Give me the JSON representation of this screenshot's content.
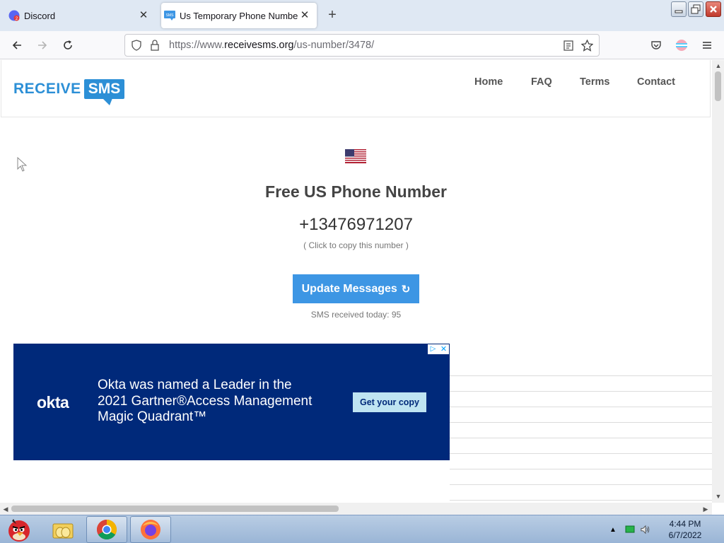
{
  "browser": {
    "tabs": [
      {
        "title": "Discord",
        "favicon": "discord-icon",
        "active": false
      },
      {
        "title": "Us Temporary Phone Numbe",
        "favicon": "receivesms-icon",
        "active": true
      }
    ],
    "new_tab_icon": "plus-icon",
    "url": {
      "prefix": "https://www.",
      "domain": "receivesms.org",
      "path": "/us-number/3478/"
    }
  },
  "site": {
    "logo": {
      "part1": "RECEIVE",
      "part2": "SMS"
    },
    "menu": [
      "Home",
      "FAQ",
      "Terms",
      "Contact"
    ],
    "title": "Free US Phone Number",
    "phone_number": "+13476971207",
    "copy_hint": "( Click to copy this number )",
    "update_button": "Update Messages",
    "update_icon": "↻",
    "sms_received": "SMS received today: 95"
  },
  "ad": {
    "brand": "okta",
    "headline": [
      "Okta was named a Leader in the",
      "2021 Gartner®Access Management",
      "Magic Quadrant™"
    ],
    "cta": "Get your copy",
    "choices_icon": "▷",
    "close_icon": "✕"
  },
  "taskbar": {
    "time": "4:44 PM",
    "date": "6/7/2022",
    "apps": [
      "angry-birds-icon",
      "folder-icon",
      "chrome-icon",
      "firefox-icon"
    ]
  },
  "colors": {
    "accent": "#3d96e4",
    "ad_background": "#00297a",
    "ad_cta": "#bfe4f2"
  }
}
